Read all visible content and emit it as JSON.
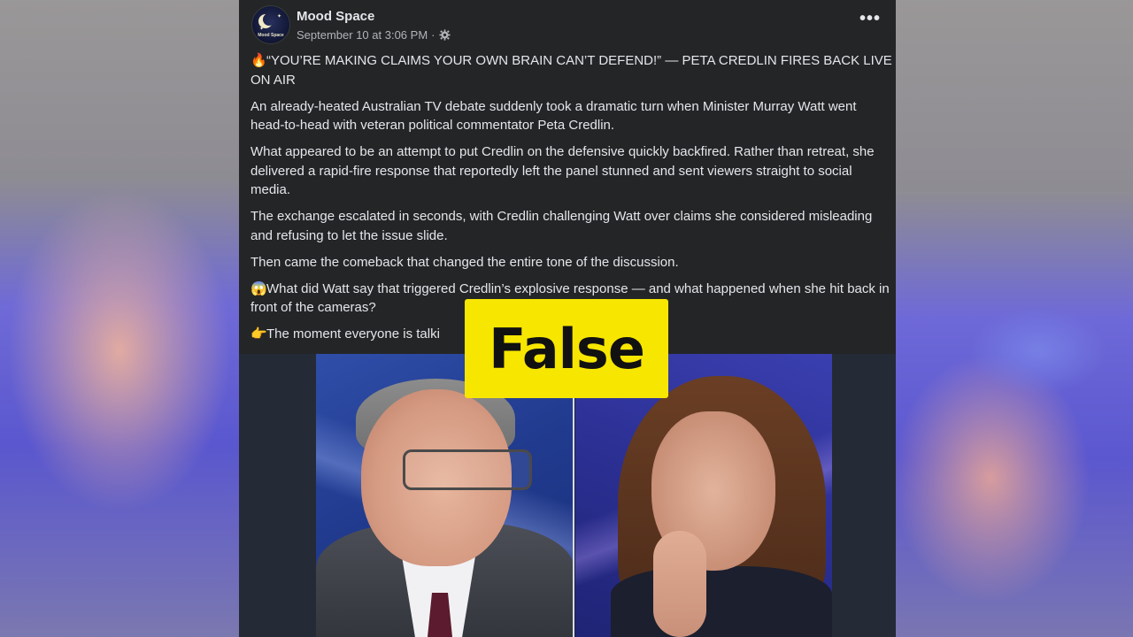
{
  "post": {
    "page_name": "Mood Space",
    "avatar_text": "Mood Space",
    "timestamp": "September 10 at 3:06 PM",
    "separator": "·",
    "more_label": "•••",
    "paragraphs": [
      {
        "emoji": "🔥",
        "text": "“YOU’RE MAKING CLAIMS YOUR OWN BRAIN CAN’T DEFEND!” — PETA CREDLIN FIRES BACK LIVE ON AIR"
      },
      {
        "emoji": "",
        "text": "An already-heated Australian TV debate suddenly took a dramatic turn when Minister Murray Watt went head-to-head with veteran political commentator Peta Credlin."
      },
      {
        "emoji": "",
        "text": "What appeared to be an attempt to put Credlin on the defensive quickly backfired. Rather than retreat, she delivered a rapid-fire response that reportedly left the panel stunned and sent viewers straight to social media."
      },
      {
        "emoji": "",
        "text": "The exchange escalated in seconds, with Credlin challenging Watt over claims she considered misleading and refusing to let the issue slide."
      },
      {
        "emoji": "",
        "text": "Then came the comeback that changed the entire tone of the discussion."
      },
      {
        "emoji": "😱",
        "text": "What did Watt say that triggered Credlin’s explosive response — and what happened when she hit back in front of the cameras?"
      },
      {
        "emoji": "👉",
        "text": "The moment everyone is talki"
      }
    ]
  },
  "fact_check_label": "False",
  "colors": {
    "post_bg": "#242526",
    "text": "#e4e6eb",
    "secondary_text": "#b0b3b8",
    "label_yellow": "#f7e600"
  }
}
